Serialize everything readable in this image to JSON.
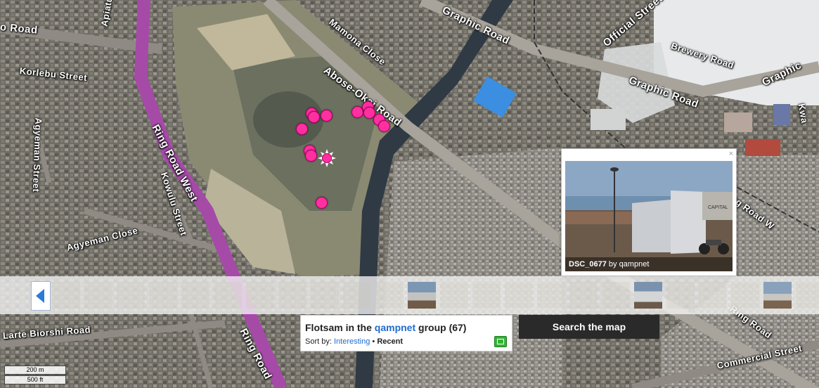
{
  "map": {
    "roads": [
      "o Road",
      "Korlebu Street",
      "Agyeman Street",
      "Ring Road West",
      "Kowulu Street",
      "Agyeman Close",
      "Mamona Close",
      "Abose-Okai Road",
      "Graphic Road",
      "Graphic Road",
      "Official Street",
      "Brewery Road",
      "Graphic",
      "Apiatu",
      "Larte Biorshi Road",
      "Ring Road W",
      "Commercial Street",
      "Kwa",
      "Ring Road",
      "Ring Road"
    ],
    "scale": {
      "metric": "200 m",
      "imperial": "500 ft"
    },
    "marker_count": 13
  },
  "popup": {
    "title": "DSC_0677",
    "by": "by qampnet",
    "sign_text": "CAPITAL",
    "close_glyph": "×"
  },
  "filmstrip": {
    "prev_icon": "left-arrow-icon",
    "thumb_count": 24
  },
  "group": {
    "title_prefix": "Flotsam in the",
    "group_name": "qampnet",
    "title_suffix": "group (67)",
    "sort_label": "Sort by:",
    "sort_interesting": "Interesting",
    "sort_separator": "•",
    "sort_recent": "Recent",
    "slideshow_icon": "slideshow-icon"
  },
  "search_button": "Search the map",
  "colors": {
    "marker": "#ff2fa0",
    "ring_road": "#a64aa8",
    "link": "#1f6bd1"
  }
}
